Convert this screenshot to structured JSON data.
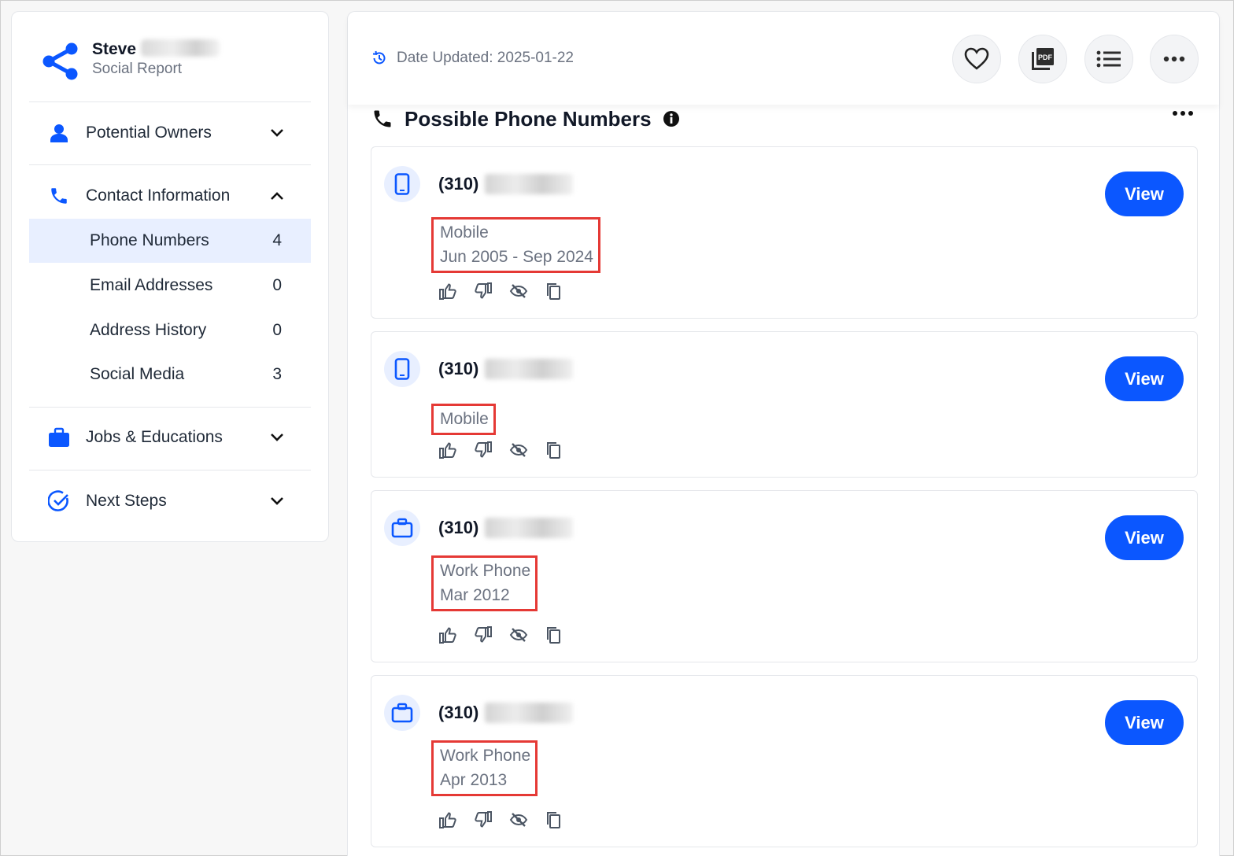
{
  "profile": {
    "name": "Steve",
    "report_type": "Social Report"
  },
  "sidebar": {
    "sections": [
      {
        "label": "Potential Owners",
        "icon": "person-icon",
        "expanded": false
      },
      {
        "label": "Contact Information",
        "icon": "phone-icon",
        "expanded": true
      },
      {
        "label": "Jobs & Educations",
        "icon": "briefcase-icon",
        "expanded": false
      },
      {
        "label": "Next Steps",
        "icon": "check-circle-icon",
        "expanded": false
      }
    ],
    "contact_items": [
      {
        "label": "Phone Numbers",
        "count": "4",
        "active": true
      },
      {
        "label": "Email Addresses",
        "count": "0",
        "active": false
      },
      {
        "label": "Address History",
        "count": "0",
        "active": false
      },
      {
        "label": "Social Media",
        "count": "3",
        "active": false
      }
    ]
  },
  "header": {
    "date_updated": "Date Updated: 2025-01-22",
    "buttons": [
      "heart-icon",
      "pdf-icon",
      "list-icon",
      "more-icon"
    ]
  },
  "section": {
    "title": "Possible Phone Numbers"
  },
  "phones": [
    {
      "number": "(310)",
      "type": "Mobile",
      "dates": "Jun 2005 - Sep 2024",
      "icon": "mobile-icon",
      "view_label": "View"
    },
    {
      "number": "(310)",
      "type": "Mobile",
      "dates": "",
      "icon": "mobile-icon",
      "view_label": "View"
    },
    {
      "number": "(310)",
      "type": "Work Phone",
      "dates": "Mar 2012",
      "icon": "briefcase-icon",
      "view_label": "View"
    },
    {
      "number": "(310)",
      "type": "Work Phone",
      "dates": "Apr 2013",
      "icon": "briefcase-icon",
      "view_label": "View"
    }
  ],
  "colors": {
    "accent": "#0b57ff",
    "highlight_box": "#e53935",
    "active_bg": "#e8efff"
  }
}
